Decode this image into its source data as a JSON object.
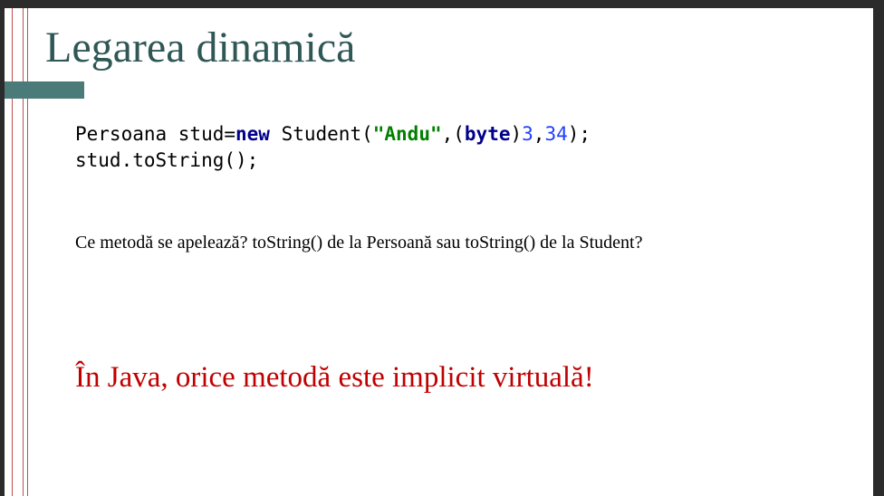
{
  "slide": {
    "title": "Legarea dinamică",
    "code": {
      "line1": {
        "t1": "Persoana stud=",
        "kw_new": "new",
        "t2": " Student(",
        "str": "\"Andu\"",
        "t3": ",(",
        "kw_byte": "byte",
        "t4": ")",
        "n1": "3",
        "t5": ",",
        "n2": "34",
        "t6": ");"
      },
      "line2": "stud.toString();"
    },
    "question": "Ce metodă se apelează? toString() de la Persoană sau toString() de la Student?",
    "statement": "În Java, orice metodă este implicit virtuală!"
  },
  "colors": {
    "title": "#2e5755",
    "accent_bar": "#4a7b79",
    "margin_lines": "#c0504d",
    "statement": "#c00000",
    "keyword": "#00008b",
    "string": "#008000",
    "number": "#1f3fff"
  }
}
